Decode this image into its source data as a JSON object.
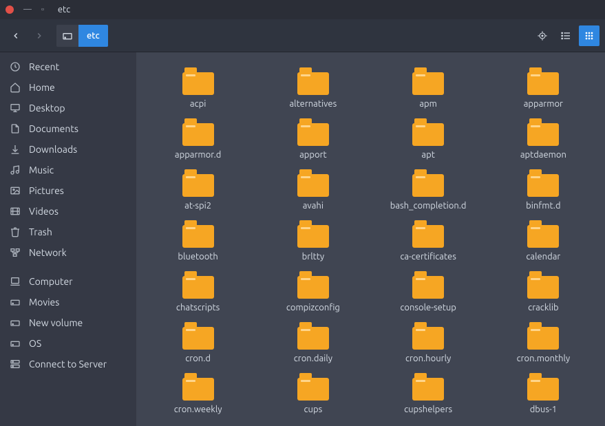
{
  "window": {
    "title": "etc"
  },
  "path": {
    "current": "etc"
  },
  "sidebar": {
    "items": [
      {
        "label": "Recent",
        "icon": "clock-icon"
      },
      {
        "label": "Home",
        "icon": "home-icon"
      },
      {
        "label": "Desktop",
        "icon": "desktop-icon"
      },
      {
        "label": "Documents",
        "icon": "document-icon"
      },
      {
        "label": "Downloads",
        "icon": "download-icon"
      },
      {
        "label": "Music",
        "icon": "music-icon"
      },
      {
        "label": "Pictures",
        "icon": "picture-icon"
      },
      {
        "label": "Videos",
        "icon": "video-icon"
      },
      {
        "label": "Trash",
        "icon": "trash-icon"
      },
      {
        "label": "Network",
        "icon": "network-icon"
      }
    ],
    "devices": [
      {
        "label": "Computer",
        "icon": "computer-icon"
      },
      {
        "label": "Movies",
        "icon": "drive-icon"
      },
      {
        "label": "New volume",
        "icon": "drive-icon"
      },
      {
        "label": "OS",
        "icon": "drive-icon"
      },
      {
        "label": "Connect to Server",
        "icon": "server-icon"
      }
    ]
  },
  "folders": [
    "acpi",
    "alternatives",
    "apm",
    "apparmor",
    "apparmor.d",
    "apport",
    "apt",
    "aptdaemon",
    "at-spi2",
    "avahi",
    "bash_completion.d",
    "binfmt.d",
    "bluetooth",
    "brltty",
    "ca-certificates",
    "calendar",
    "chatscripts",
    "compizconfig",
    "console-setup",
    "cracklib",
    "cron.d",
    "cron.daily",
    "cron.hourly",
    "cron.monthly",
    "cron.weekly",
    "cups",
    "cupshelpers",
    "dbus-1"
  ]
}
